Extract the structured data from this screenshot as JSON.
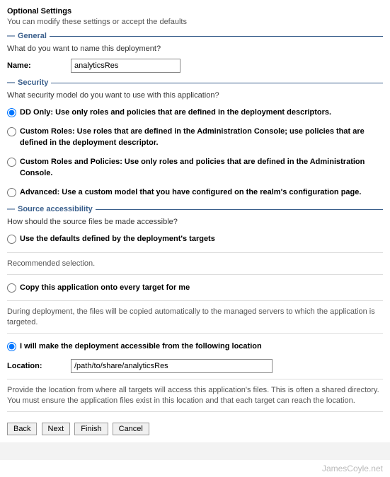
{
  "header": {
    "title": "Optional Settings",
    "subtitle": "You can modify these settings or accept the defaults"
  },
  "sections": {
    "general": {
      "title": "General",
      "prompt": "What do you want to name this deployment?",
      "name_label": "Name:",
      "name_value": "analyticsRes"
    },
    "security": {
      "title": "Security",
      "prompt": "What security model do you want to use with this application?",
      "options": {
        "dd_only": "DD Only: Use only roles and policies that are defined in the deployment descriptors.",
        "custom_roles": "Custom Roles: Use roles that are defined in the Administration Console; use policies that are defined in the deployment descriptor.",
        "custom_roles_policies": "Custom Roles and Policies: Use only roles and policies that are defined in the Administration Console.",
        "advanced": "Advanced: Use a custom model that you have configured on the realm's configuration page."
      }
    },
    "source": {
      "title": "Source accessibility",
      "prompt": "How should the source files be made accessible?",
      "options": {
        "defaults": "Use the defaults defined by the deployment's targets",
        "copy": "Copy this application onto every target for me",
        "location": "I will make the deployment accessible from the following location"
      },
      "recommended_note": "Recommended selection.",
      "copy_note": "During deployment, the files will be copied automatically to the managed servers to which the application is targeted.",
      "location_label": "Location:",
      "location_value": "/path/to/share/analyticsRes",
      "location_note": "Provide the location from where all targets will access this application's files. This is often a shared directory. You must ensure the application files exist in this location and that each target can reach the location."
    }
  },
  "buttons": {
    "back": "Back",
    "next": "Next",
    "finish": "Finish",
    "cancel": "Cancel"
  },
  "watermark": "JamesCoyle.net"
}
